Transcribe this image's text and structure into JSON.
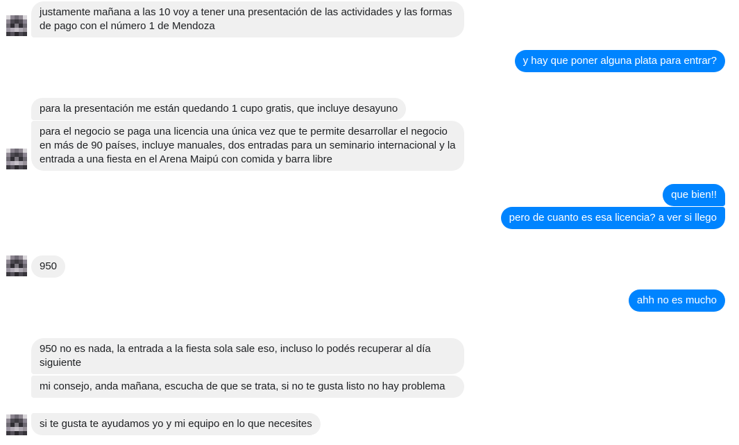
{
  "conversation": {
    "messages": [
      {
        "id": "m1",
        "dir": "in",
        "text": "justamente mañana a las 10 voy a tener una presentación de las actividades y las formas de pago con el número 1 de Mendoza"
      },
      {
        "id": "m2",
        "dir": "out",
        "text": "y hay que poner alguna plata para entrar?"
      },
      {
        "id": "m3",
        "dir": "in",
        "text": "para la presentación me están quedando 1 cupo gratis, que incluye desayuno"
      },
      {
        "id": "m4",
        "dir": "in",
        "text": "para el negocio se paga una licencia una única vez que te permite desarrollar el negocio en más de 90 países, incluye manuales, dos entradas para un seminario internacional y la entrada a una fiesta en el Arena Maipú con comida y barra libre"
      },
      {
        "id": "m5",
        "dir": "out",
        "text": "que bien!!"
      },
      {
        "id": "m6",
        "dir": "out",
        "text": "pero de cuanto es esa licencia? a ver si llego"
      },
      {
        "id": "m7",
        "dir": "in",
        "text": "950"
      },
      {
        "id": "m8",
        "dir": "out",
        "text": "ahh no es mucho"
      },
      {
        "id": "m9",
        "dir": "in",
        "text": "950 no es nada, la entrada a la fiesta sola sale eso, incluso lo podés recuperar al día siguiente"
      },
      {
        "id": "m10",
        "dir": "in",
        "text": "mi consejo, anda mañana, escucha de que se trata, si no te gusta listo no hay problema"
      },
      {
        "id": "m11",
        "dir": "in",
        "text": "si te gusta te ayudamos yo y mi equipo en lo que necesites"
      }
    ]
  },
  "colors": {
    "incoming_bubble": "#f0f0f0",
    "outgoing_bubble": "#0084ff",
    "incoming_text": "#1c1e21",
    "outgoing_text": "#ffffff"
  }
}
